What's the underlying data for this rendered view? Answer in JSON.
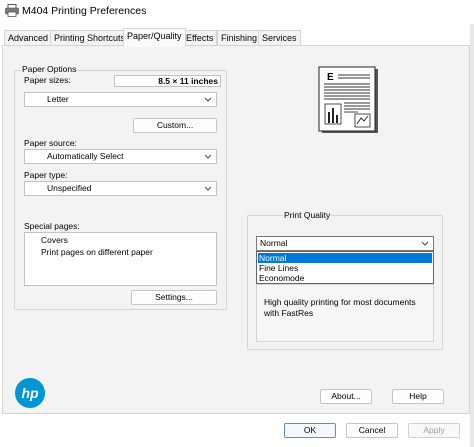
{
  "window": {
    "title": "M404 Printing Preferences"
  },
  "tabs": [
    {
      "label": "Advanced"
    },
    {
      "label": "Printing Shortcuts"
    },
    {
      "label": "Paper/Quality"
    },
    {
      "label": "Effects"
    },
    {
      "label": "Finishing"
    },
    {
      "label": "Services"
    }
  ],
  "active_tab": "Paper/Quality",
  "paper_options": {
    "group_label": "Paper Options",
    "paper_sizes_label": "Paper sizes:",
    "paper_size_dimensions": "8.5 × 11 inches",
    "paper_size_value": "Letter",
    "custom_button": "Custom...",
    "paper_source_label": "Paper source:",
    "paper_source_value": "Automatically Select",
    "paper_type_label": "Paper type:",
    "paper_type_value": "Unspecified",
    "special_pages_label": "Special pages:",
    "special_pages_items": [
      "Covers",
      "Print pages on different paper"
    ],
    "settings_button": "Settings..."
  },
  "print_quality": {
    "group_label": "Print Quality",
    "selected": "Normal",
    "options": [
      "Normal",
      "Fine Lines",
      "Economode"
    ],
    "highlighted_option": "Normal",
    "description": "High quality printing for most documents with FastRes"
  },
  "buttons": {
    "about": "About...",
    "help": "Help",
    "ok": "OK",
    "cancel": "Cancel",
    "apply": "Apply"
  },
  "icons": {
    "title": "printer-icon",
    "brand": "hp-logo",
    "document_preview": "document-preview-icon",
    "dropdown": "chevron-down-icon"
  },
  "colors": {
    "accent": "#0078d7",
    "hp_logo": "#0096d6",
    "panel_background": "#f3f3f3"
  }
}
